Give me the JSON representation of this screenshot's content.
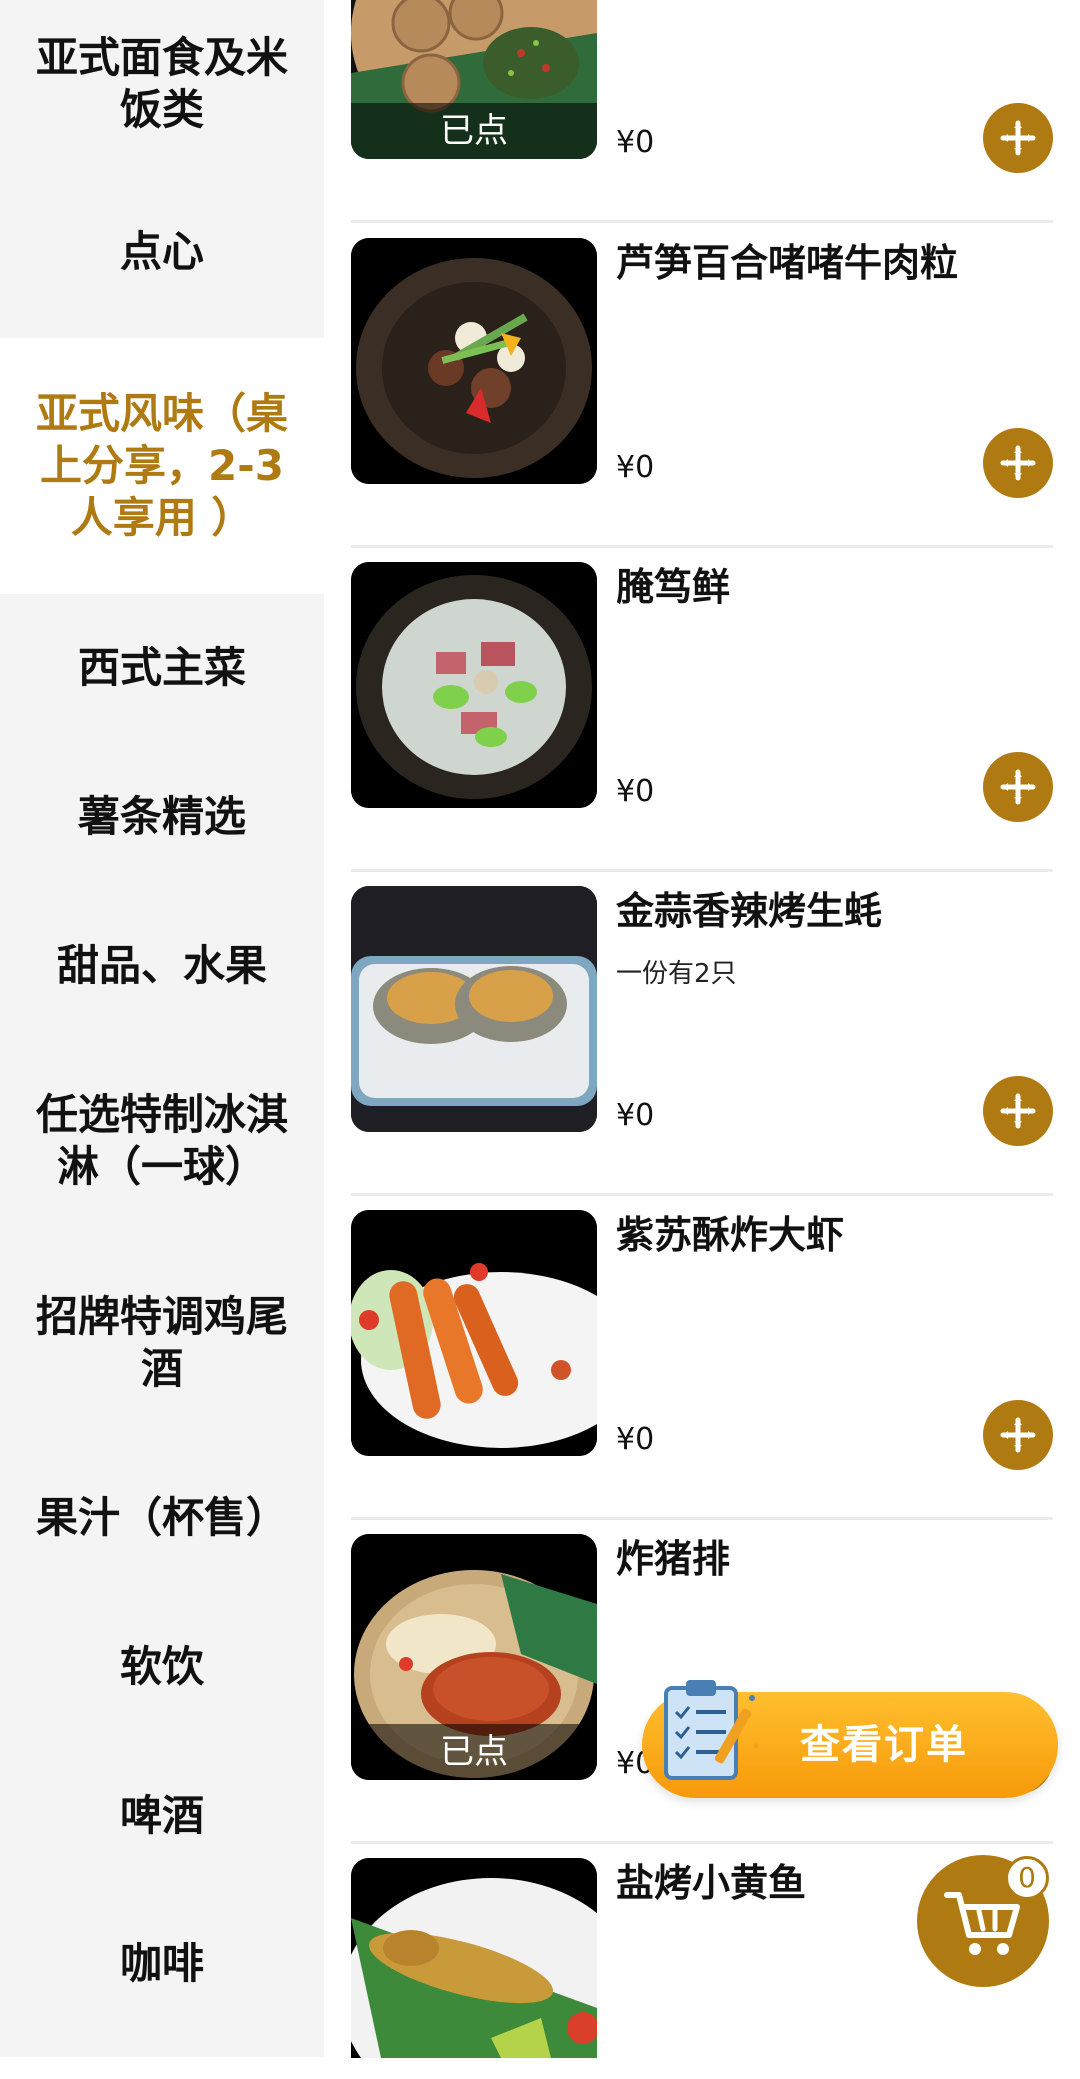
{
  "sidebar": {
    "categories": [
      {
        "label": "亚式面食及米饭类"
      },
      {
        "label": "点心"
      },
      {
        "label": "亚式风味（桌上分享，2-3人享用 ）"
      },
      {
        "label": "西式主菜"
      },
      {
        "label": "薯条精选"
      },
      {
        "label": "甜品、水果"
      },
      {
        "label": "任选特制冰淇淋（一球）"
      },
      {
        "label": "招牌特调鸡尾酒"
      },
      {
        "label": "果汁（杯售）"
      },
      {
        "label": "软饮"
      },
      {
        "label": "啤酒"
      },
      {
        "label": "咖啡"
      }
    ],
    "active_index": 2
  },
  "items": [
    {
      "name": "",
      "desc": "",
      "price": "¥0",
      "ordered_label": "已点"
    },
    {
      "name": "芦笋百合啫啫牛肉粒",
      "desc": "",
      "price": "¥0",
      "ordered_label": ""
    },
    {
      "name": "腌笃鲜",
      "desc": "",
      "price": "¥0",
      "ordered_label": ""
    },
    {
      "name": "金蒜香辣烤生蚝",
      "desc": "一份有2只",
      "price": "¥0",
      "ordered_label": ""
    },
    {
      "name": "紫苏酥炸大虾",
      "desc": "",
      "price": "¥0",
      "ordered_label": ""
    },
    {
      "name": "炸猪排",
      "desc": "",
      "price": "¥0",
      "ordered_label": "已点"
    },
    {
      "name": "盐烤小黄鱼",
      "desc": "",
      "price": "",
      "ordered_label": ""
    }
  ],
  "order_button": {
    "label": "查看订单",
    "icon": "clipboard-checklist-icon"
  },
  "cart": {
    "count": "0",
    "icon": "shopping-cart-icon"
  },
  "colors": {
    "accent": "#b07a12",
    "order_button_gradient": [
      "#ffbf2e",
      "#f79a0a"
    ],
    "sidebar_bg": "#f4f4f4",
    "active_category_bg": "#ffffff"
  }
}
